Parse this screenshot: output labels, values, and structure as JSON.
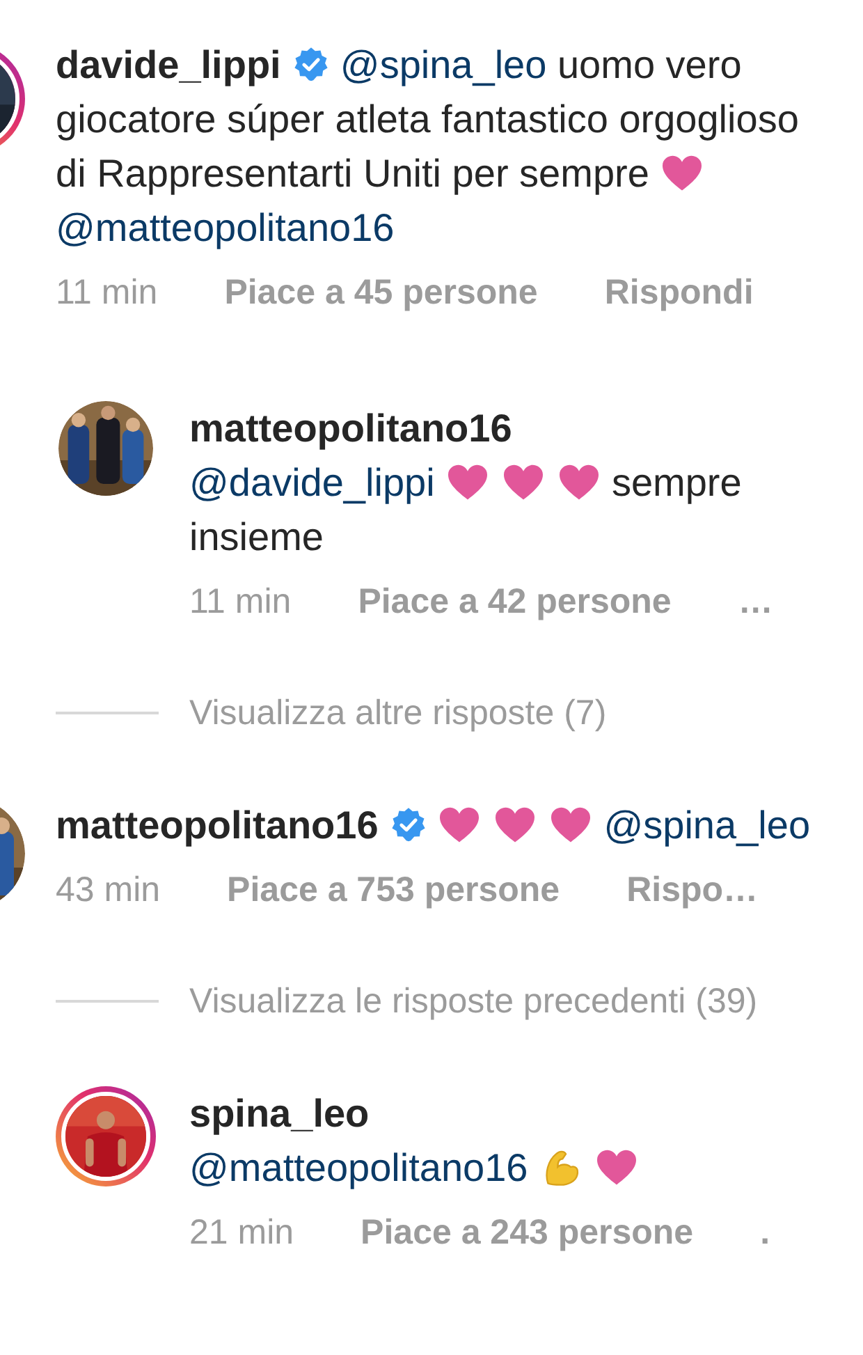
{
  "items": [
    {
      "kind": "comment",
      "story": true,
      "username": "davide_lippi",
      "verified": true,
      "body": [
        {
          "kind": "mention",
          "text": "@spina_leo"
        },
        {
          "kind": "text",
          "text": "uomo vero giocatore súper atleta fantastico orgoglioso di Rappresentarti Uniti per sempre"
        },
        {
          "kind": "heart"
        },
        {
          "kind": "mention",
          "text": "@matteopolitano16"
        }
      ],
      "time": "11 min",
      "likes": "Piace a 45 persone",
      "action": "Rispondi"
    },
    {
      "kind": "reply",
      "story": false,
      "username": "matteopolitano16",
      "verified": false,
      "body": [
        {
          "kind": "mention",
          "text": "@davide_lippi"
        },
        {
          "kind": "heart"
        },
        {
          "kind": "heart"
        },
        {
          "kind": "heart"
        },
        {
          "kind": "text",
          "text": "sempre insieme"
        }
      ],
      "time": "11 min",
      "likes": "Piace a 42 persone",
      "action": "…"
    },
    {
      "kind": "more",
      "label": "Visualizza altre risposte (7)"
    },
    {
      "kind": "comment",
      "story": false,
      "username": "matteopolitano16",
      "verified": true,
      "body": [
        {
          "kind": "heart"
        },
        {
          "kind": "heart"
        },
        {
          "kind": "heart"
        },
        {
          "kind": "mention",
          "text": "@spina_leo"
        }
      ],
      "time": "43 min",
      "likes": "Piace a 753 persone",
      "action": "Rispo…"
    },
    {
      "kind": "more",
      "label": "Visualizza le risposte precedenti (39)"
    },
    {
      "kind": "reply",
      "story": true,
      "username": "spina_leo",
      "verified": false,
      "body": [
        {
          "kind": "mention",
          "text": "@matteopolitano16"
        },
        {
          "kind": "muscle"
        },
        {
          "kind": "heart"
        }
      ],
      "time": "21 min",
      "likes": "Piace a 243 persone",
      "action": "."
    }
  ]
}
